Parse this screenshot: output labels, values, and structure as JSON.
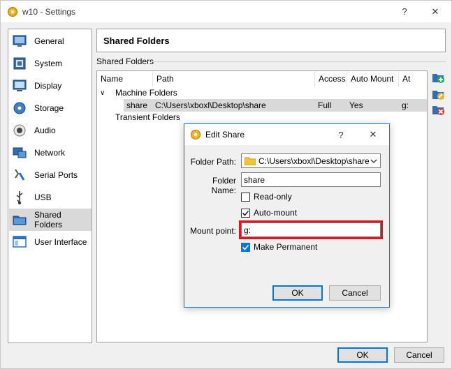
{
  "window": {
    "title": "w10 - Settings",
    "help_glyph": "?",
    "close_glyph": "✕"
  },
  "sidebar": {
    "items": [
      {
        "label": "General",
        "icon": "general-icon"
      },
      {
        "label": "System",
        "icon": "system-icon"
      },
      {
        "label": "Display",
        "icon": "display-icon"
      },
      {
        "label": "Storage",
        "icon": "storage-icon"
      },
      {
        "label": "Audio",
        "icon": "audio-icon"
      },
      {
        "label": "Network",
        "icon": "network-icon"
      },
      {
        "label": "Serial Ports",
        "icon": "serial-ports-icon"
      },
      {
        "label": "USB",
        "icon": "usb-icon"
      },
      {
        "label": "Shared Folders",
        "icon": "shared-folders-icon",
        "selected": true
      },
      {
        "label": "User Interface",
        "icon": "user-interface-icon"
      }
    ]
  },
  "page": {
    "header": "Shared Folders",
    "group_label": "Shared Folders"
  },
  "folders_table": {
    "columns": [
      "Name",
      "Path",
      "Access",
      "Auto Mount",
      "At"
    ],
    "machine_group": "Machine Folders",
    "row": {
      "name": "share",
      "path": "C:\\Users\\xboxl\\Desktop\\share",
      "access": "Full",
      "auto_mount": "Yes",
      "at": "g:"
    },
    "transient_group": "Transient Folders",
    "expand_glyph": "∨"
  },
  "footer": {
    "ok": "OK",
    "cancel": "Cancel"
  },
  "dialog": {
    "title": "Edit Share",
    "help_glyph": "?",
    "close_glyph": "✕",
    "folder_path_label": "Folder Path:",
    "folder_path_value": "C:\\Users\\xboxl\\Desktop\\share",
    "folder_name_label": "Folder Name:",
    "folder_name_value": "share",
    "read_only_label": "Read-only",
    "read_only_checked": false,
    "auto_mount_label": "Auto-mount",
    "auto_mount_checked": true,
    "mount_point_label": "Mount point:",
    "mount_point_value": "g:",
    "make_permanent_label": "Make Permanent",
    "make_permanent_checked": true,
    "ok": "OK",
    "cancel": "Cancel"
  },
  "colors": {
    "accent": "#0078d7",
    "highlight": "#e0141e",
    "selected_bg": "#d9d9d9",
    "check_blue": "#0078d7"
  }
}
